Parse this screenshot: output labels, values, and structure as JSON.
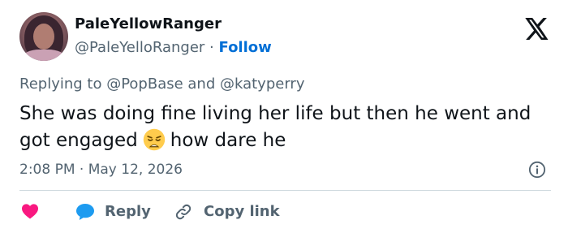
{
  "author": {
    "display_name": "PaleYellowRanger",
    "handle": "@PaleYelloRanger",
    "separator": "·",
    "follow_label": "Follow"
  },
  "reply_context": {
    "text": "Replying to @PopBase and @katyperry"
  },
  "tweet": {
    "text_part1": "She was doing fine living her life but then he went and got engaged",
    "emoji": "weary-face",
    "text_part2": "how dare he"
  },
  "meta": {
    "timestamp": "2:08 PM · May 12, 2026"
  },
  "actions": {
    "reply_label": "Reply",
    "copy_link_label": "Copy link"
  },
  "colors": {
    "text_primary": "#0f1419",
    "text_secondary": "#536471",
    "link_blue": "#006fd6",
    "heart_red": "#f91880",
    "reply_blue": "#1d9bf0",
    "divider": "#cfd9de"
  }
}
